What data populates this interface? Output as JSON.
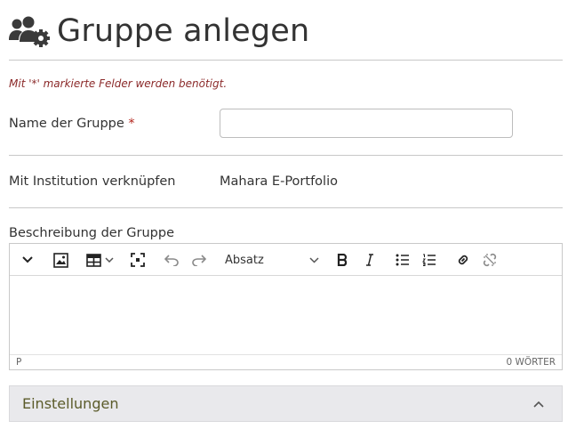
{
  "page": {
    "title": "Gruppe anlegen",
    "icon": "users-gear-icon"
  },
  "form": {
    "required_note": "Mit '*' markierte Felder werden benötigt.",
    "group_name": {
      "label": "Name der Gruppe",
      "required_mark": "*",
      "value": "",
      "placeholder": ""
    },
    "institution": {
      "label": "Mit Institution verknüpfen",
      "value": "Mahara E-Portfolio"
    },
    "description": {
      "label": "Beschreibung der Gruppe",
      "toolbar": {
        "items": [
          "chevron-down-icon",
          "image-icon",
          "table-icon",
          "fullscreen-icon",
          "undo-icon",
          "redo-icon",
          "bold-icon",
          "italic-icon",
          "bullet-list-icon",
          "numbered-list-icon",
          "link-icon",
          "unlink-icon"
        ],
        "block_format": "Absatz"
      },
      "status": {
        "path": "P",
        "word_count": "0 WÖRTER"
      }
    }
  },
  "settings_panel": {
    "title": "Einstellungen",
    "state": "expanded"
  },
  "colors": {
    "required": "#b3261e",
    "note": "#8b2a2a",
    "panel_bg": "#e9e9ec"
  }
}
